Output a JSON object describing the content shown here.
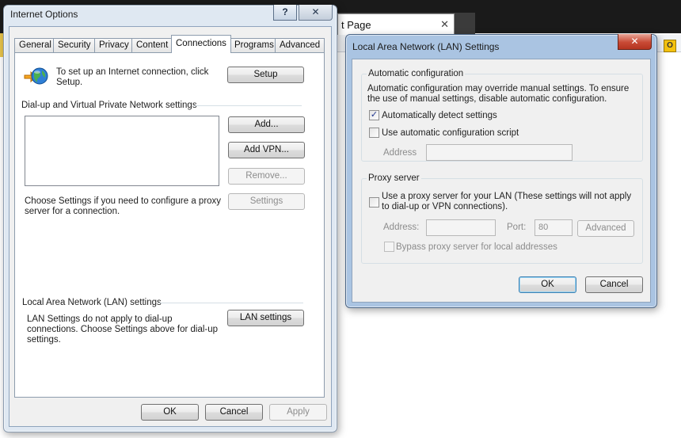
{
  "background_browser": {
    "tab_title": "t Page",
    "tab_close": "✕",
    "toolbar_badge": "O"
  },
  "internet_options": {
    "title": "Internet Options",
    "help_button": "?",
    "close_button": "✕",
    "tabs": [
      {
        "label": "General"
      },
      {
        "label": "Security"
      },
      {
        "label": "Privacy"
      },
      {
        "label": "Content"
      },
      {
        "label": "Connections",
        "active": true
      },
      {
        "label": "Programs"
      },
      {
        "label": "Advanced"
      }
    ],
    "setup_text": "To set up an Internet connection, click Setup.",
    "setup_button": "Setup",
    "dialup_heading": "Dial-up and Virtual Private Network settings",
    "add_button": "Add...",
    "add_vpn_button": "Add VPN...",
    "remove_button": "Remove...",
    "choose_settings_text": "Choose Settings if you need to configure a proxy server for a connection.",
    "settings_button": "Settings",
    "lan_heading": "Local Area Network (LAN) settings",
    "lan_text": "LAN Settings do not apply to dial-up connections. Choose Settings above for dial-up settings.",
    "lan_settings_button": "LAN settings",
    "ok_button": "OK",
    "cancel_button": "Cancel",
    "apply_button": "Apply"
  },
  "lan_dialog": {
    "title": "Local Area Network (LAN) Settings",
    "close_button": "✕",
    "auto_config_title": "Automatic configuration",
    "auto_config_desc": "Automatic configuration may override manual settings.  To ensure the use of manual settings, disable automatic configuration.",
    "auto_detect_label": "Automatically detect settings",
    "auto_detect_checked": true,
    "auto_script_label": "Use automatic configuration script",
    "auto_script_checked": false,
    "address_label": "Address",
    "address_value": "",
    "proxy_title": "Proxy server",
    "use_proxy_label": "Use a proxy server for your LAN (These settings will not apply to dial-up or VPN connections).",
    "use_proxy_checked": false,
    "proxy_address_label": "Address:",
    "proxy_address_value": "",
    "port_label": "Port:",
    "port_value": "80",
    "advanced_button": "Advanced",
    "bypass_label": "Bypass proxy server for local addresses",
    "bypass_checked": false,
    "ok_button": "OK",
    "cancel_button": "Cancel"
  }
}
